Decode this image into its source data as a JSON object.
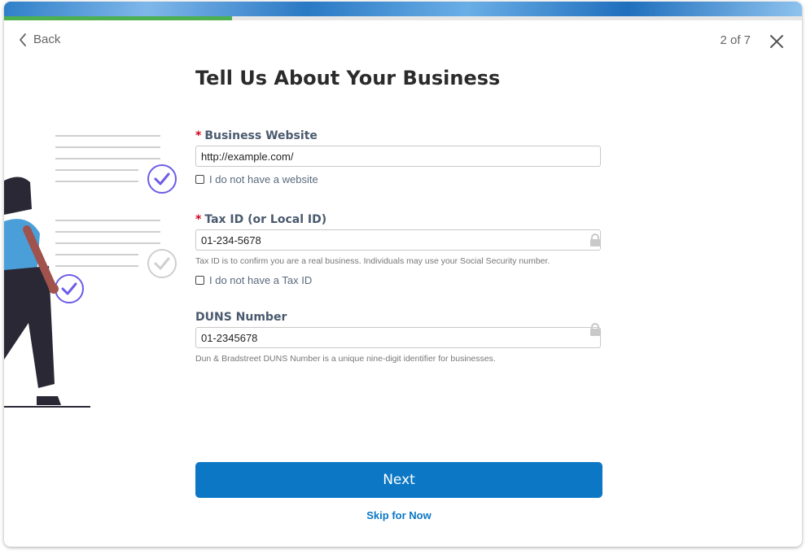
{
  "header": {
    "back_label": "Back",
    "step_text": "2 of 7",
    "progress_fraction": 0.286
  },
  "form": {
    "title": "Tell Us About Your Business",
    "website": {
      "required_marker": "*",
      "label": "Business Website",
      "value": "http://example.com/",
      "no_value_checkbox": "I do not have a website",
      "checked": false
    },
    "tax_id": {
      "required_marker": "*",
      "label": "Tax ID (or Local ID)",
      "value": "01-234-5678",
      "help": "Tax ID is to confirm you are a real business. Individuals may use your Social Security number.",
      "no_value_checkbox": "I do not have a Tax ID",
      "checked": false
    },
    "duns": {
      "label": "DUNS Number",
      "value": "01-2345678",
      "help": "Dun & Bradstreet DUNS Number is a unique nine-digit identifier for businesses."
    }
  },
  "actions": {
    "next_label": "Next",
    "skip_label": "Skip for Now"
  },
  "colors": {
    "primary": "#0b77c5",
    "progress": "#4caf50",
    "check_accent": "#6c5ce7"
  }
}
